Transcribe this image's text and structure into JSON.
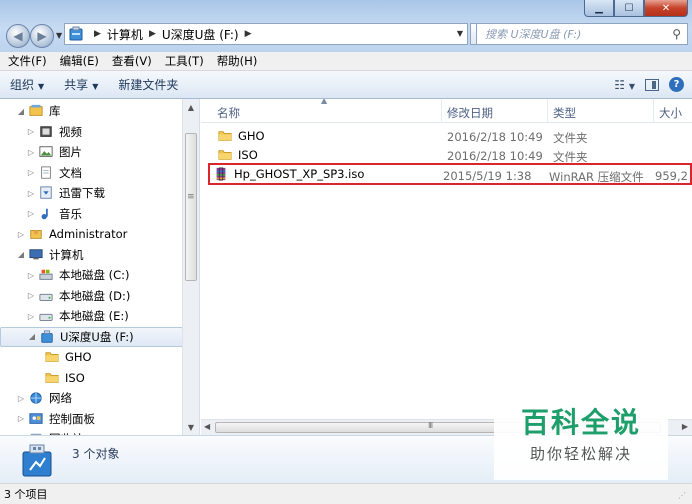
{
  "window": {
    "min_label": "▁",
    "max_label": "☐",
    "close_label": "✕"
  },
  "address": {
    "crumbs": [
      "计算机",
      "U深度U盘 (F:)"
    ],
    "search_placeholder": "搜索 U深度U盘 (F:)"
  },
  "menubar": {
    "items": [
      "文件(F)",
      "编辑(E)",
      "查看(V)",
      "工具(T)",
      "帮助(H)"
    ]
  },
  "toolbar": {
    "organize": "组织",
    "share": "共享",
    "new_folder": "新建文件夹"
  },
  "nav": {
    "items": [
      {
        "label": "库",
        "icon": "library-icon",
        "level": 1,
        "expanded": true
      },
      {
        "label": "视频",
        "icon": "video-icon",
        "level": 2
      },
      {
        "label": "图片",
        "icon": "picture-icon",
        "level": 2
      },
      {
        "label": "文档",
        "icon": "document-icon",
        "level": 2
      },
      {
        "label": "迅雷下载",
        "icon": "download-icon",
        "level": 2
      },
      {
        "label": "音乐",
        "icon": "music-icon",
        "level": 2
      },
      {
        "label": "Administrator",
        "icon": "user-folder-icon",
        "level": 1
      },
      {
        "label": "计算机",
        "icon": "computer-icon",
        "level": 1,
        "expanded": true
      },
      {
        "label": "本地磁盘 (C:)",
        "icon": "system-drive-icon",
        "level": 2
      },
      {
        "label": "本地磁盘 (D:)",
        "icon": "drive-icon",
        "level": 2
      },
      {
        "label": "本地磁盘 (E:)",
        "icon": "drive-icon",
        "level": 2
      },
      {
        "label": "U深度U盘 (F:)",
        "icon": "usb-drive-icon",
        "level": 2,
        "expanded": true,
        "selected": true
      },
      {
        "label": "GHO",
        "icon": "folder-icon",
        "level": 3
      },
      {
        "label": "ISO",
        "icon": "folder-icon",
        "level": 3
      },
      {
        "label": "网络",
        "icon": "network-icon",
        "level": 1
      },
      {
        "label": "控制面板",
        "icon": "control-panel-icon",
        "level": 1
      },
      {
        "label": "回收站",
        "icon": "recycle-bin-icon",
        "level": 1
      }
    ]
  },
  "columns": {
    "name": "名称",
    "date": "修改日期",
    "type": "类型",
    "size": "大小"
  },
  "files": [
    {
      "name": "GHO",
      "date": "2016/2/18 10:49",
      "type": "文件夹",
      "size": "",
      "icon": "folder-icon"
    },
    {
      "name": "ISO",
      "date": "2016/2/18 10:49",
      "type": "文件夹",
      "size": "",
      "icon": "folder-icon"
    },
    {
      "name": "Hp_GHOST_XP_SP3.iso",
      "date": "2015/5/19 1:38",
      "type": "WinRAR 压缩文件",
      "size": "959,2",
      "icon": "winrar-archive-icon",
      "highlighted": true
    }
  ],
  "details": {
    "count": "3 个对象"
  },
  "status": {
    "text": "3 个项目"
  },
  "watermark": {
    "title": "百科全说",
    "subtitle": "助你轻松解决"
  },
  "colors": {
    "highlight_border": "#d9262b",
    "watermark_green": "#1e9e6b"
  }
}
